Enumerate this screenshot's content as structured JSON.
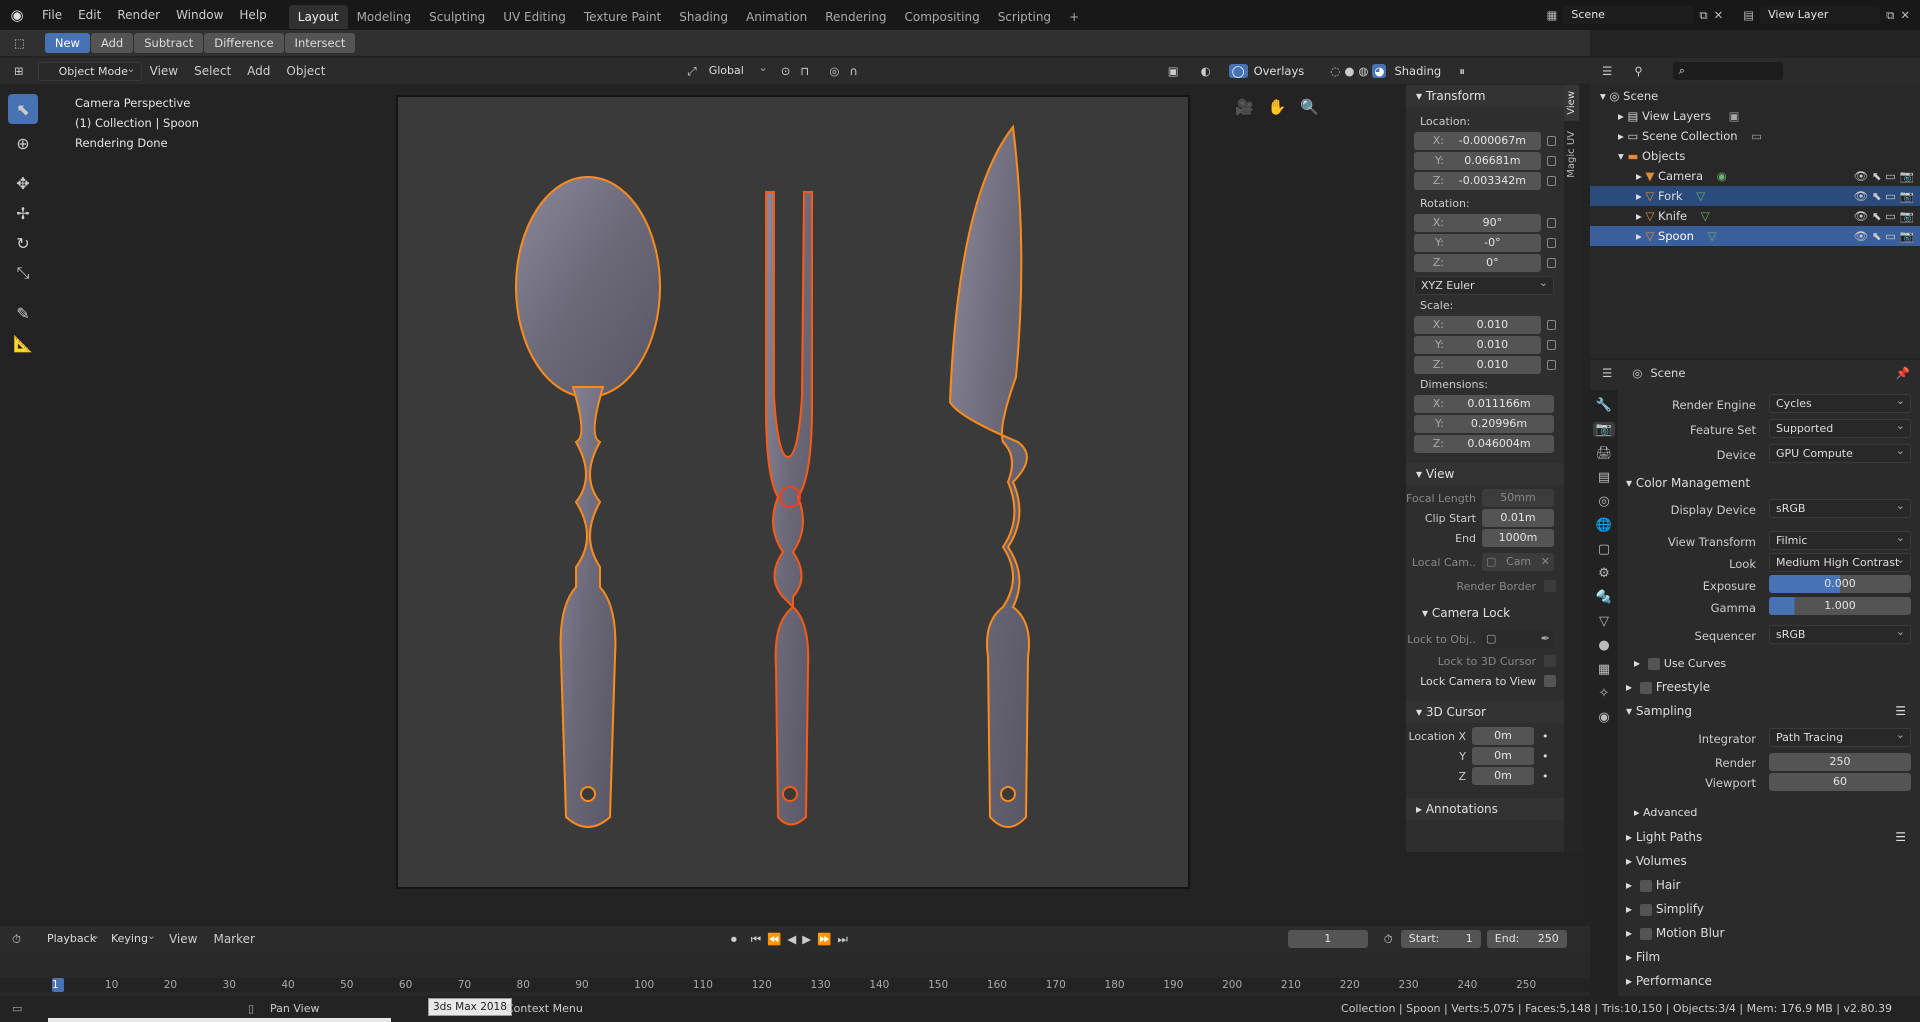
{
  "app": {
    "menus": [
      "File",
      "Edit",
      "Render",
      "Window",
      "Help"
    ],
    "workspaces": [
      "Layout",
      "Modeling",
      "Sculpting",
      "UV Editing",
      "Texture Paint",
      "Shading",
      "Animation",
      "Rendering",
      "Compositing",
      "Scripting"
    ],
    "active_workspace": "Layout",
    "scene": "Scene",
    "view_layer": "View Layer"
  },
  "toolheader": {
    "new": "New",
    "add": "Add",
    "subtract": "Subtract",
    "difference": "Difference",
    "intersect": "Intersect"
  },
  "viewport_header": {
    "mode": "Object Mode",
    "view": "View",
    "select": "Select",
    "add": "Add",
    "object": "Object",
    "orientation": "Global",
    "overlays": "Overlays",
    "shading": "Shading"
  },
  "viewport": {
    "info1": "Camera Perspective",
    "info2": "(1) Collection | Spoon",
    "info3": "Rendering Done"
  },
  "npanel": {
    "tabs": [
      "View",
      "Magic UV"
    ],
    "transform": {
      "title": "Transform",
      "location_label": "Location:",
      "loc_x": "-0.000067m",
      "loc_y": "0.06681m",
      "loc_z": "-0.003342m",
      "loc_x_l": "X:",
      "loc_y_l": "Y:",
      "loc_z_l": "Z:",
      "rotation_label": "Rotation:",
      "rot_x": "90°",
      "rot_y": "-0°",
      "rot_z": "0°",
      "rot_mode": "XYZ Euler",
      "scale_label": "Scale:",
      "sc_x": "0.010",
      "sc_y": "0.010",
      "sc_z": "0.010",
      "dim_label": "Dimensions:",
      "dim_x": "0.011166m",
      "dim_y": "0.20996m",
      "dim_z": "0.046004m",
      "x": "X:",
      "y": "Y:",
      "z": "Z:"
    },
    "view": {
      "title": "View",
      "focal_label": "Focal Length",
      "focal": "50mm",
      "clip_start_label": "Clip Start",
      "clip_start": "0.01m",
      "end_label": "End",
      "end": "1000m",
      "local_cam_label": "Local Cam..",
      "local_cam": "Cam",
      "render_border": "Render Border"
    },
    "camera_lock": {
      "title": "Camera Lock",
      "lock_obj": "Lock to Obj..",
      "lock_cursor": "Lock to 3D Cursor",
      "lock_view": "Lock Camera to View"
    },
    "cursor": {
      "title": "3D Cursor",
      "loc_x_l": "Location X",
      "y_l": "Y",
      "z_l": "Z",
      "x": "0m",
      "y": "0m",
      "z": "0m"
    },
    "annotations": "Annotations"
  },
  "outliner": {
    "rows": [
      {
        "label": "Scene"
      },
      {
        "label": "View Layers"
      },
      {
        "label": "Scene Collection"
      },
      {
        "label": "Objects"
      },
      {
        "label": "Camera"
      },
      {
        "label": "Fork"
      },
      {
        "label": "Knife"
      },
      {
        "label": "Spoon"
      }
    ]
  },
  "properties": {
    "context": "Scene",
    "render_engine_label": "Render Engine",
    "render_engine": "Cycles",
    "feature_set_label": "Feature Set",
    "feature_set": "Supported",
    "device_label": "Device",
    "device": "GPU Compute",
    "color_mgmt": "Color Management",
    "display_device_label": "Display Device",
    "display_device": "sRGB",
    "view_transform_label": "View Transform",
    "view_transform": "Filmic",
    "look_label": "Look",
    "look": "Medium High Contrast",
    "exposure_label": "Exposure",
    "exposure": "0.000",
    "gamma_label": "Gamma",
    "gamma": "1.000",
    "sequencer_label": "Sequencer",
    "sequencer": "sRGB",
    "use_curves": "Use Curves",
    "freestyle": "Freestyle",
    "sampling": "Sampling",
    "integrator_label": "Integrator",
    "integrator": "Path Tracing",
    "render_label": "Render",
    "render": "250",
    "viewport_label": "Viewport",
    "viewport": "60",
    "advanced": "Advanced",
    "light_paths": "Light Paths",
    "volumes": "Volumes",
    "hair": "Hair",
    "simplify": "Simplify",
    "motion_blur": "Motion Blur",
    "film": "Film",
    "performance": "Performance"
  },
  "timeline": {
    "playback": "Playback",
    "keying": "Keying",
    "view": "View",
    "marker": "Marker",
    "current_frame": "1",
    "start_label": "Start:",
    "start": "1",
    "end_label": "End:",
    "end": "250",
    "ticks": [
      "1",
      "10",
      "20",
      "30",
      "40",
      "50",
      "60",
      "70",
      "80",
      "90",
      "100",
      "110",
      "120",
      "130",
      "140",
      "150",
      "160",
      "170",
      "180",
      "190",
      "200",
      "210",
      "220",
      "230",
      "240",
      "250"
    ]
  },
  "statusbar": {
    "pan_view": "Pan View",
    "tooltip": "3ds Max 2018",
    "context_menu": "Context Menu",
    "stats": "Collection | Spoon | Verts:5,075 | Faces:5,148 | Tris:10,150 | Objects:3/4 | Mem: 176.9 MB | v2.80.39"
  }
}
